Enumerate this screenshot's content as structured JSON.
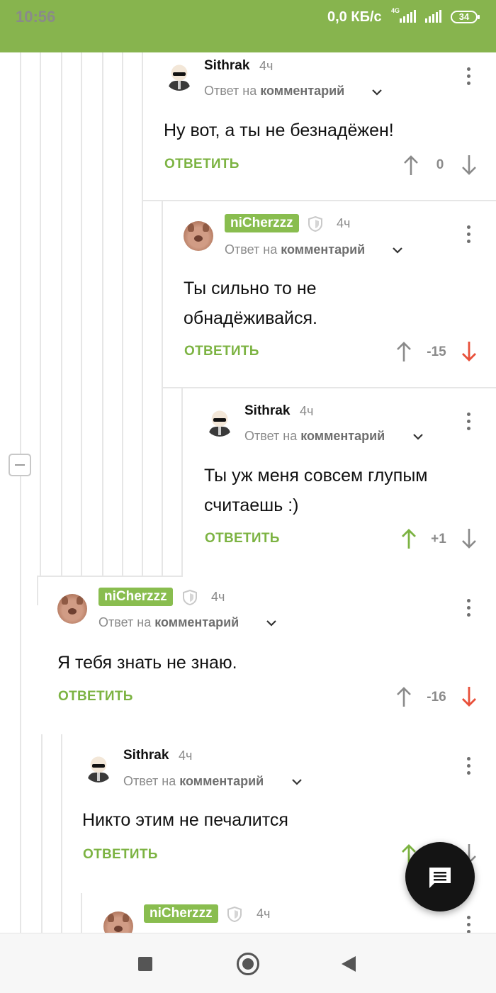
{
  "status_bar": {
    "time": "10:56",
    "net_speed": "0,0 КБ/с",
    "network_type": "4G",
    "battery": "34"
  },
  "icons": {
    "shield": "shield-icon",
    "chevron": "chevron-down-icon",
    "more": "more-vertical-icon",
    "upvote": "arrow-up-icon",
    "downvote": "arrow-down-icon",
    "fab": "comment-icon"
  },
  "colors": {
    "accent": "#87b44e",
    "badge": "#89bd4f",
    "reply_label": "#7cb342",
    "upvoted": "#7cb342",
    "downvoted": "#e8503a",
    "neutral_arrow": "#8a8a8a"
  },
  "comments": [
    {
      "author": "Sithrak",
      "author_badge": false,
      "time": "4ч",
      "reply_prefix": "Ответ на",
      "reply_target": "комментарий",
      "text": "Ну вот, а ты не безнадёжен!",
      "reply_label": "ОТВЕТИТЬ",
      "score": "0",
      "vote": "none"
    },
    {
      "author": "niCherzzz",
      "author_badge": true,
      "time": "4ч",
      "reply_prefix": "Ответ на",
      "reply_target": "комментарий",
      "text": "Ты сильно то не обнадёживайся.",
      "reply_label": "ОТВЕТИТЬ",
      "score": "-15",
      "vote": "down"
    },
    {
      "author": "Sithrak",
      "author_badge": false,
      "time": "4ч",
      "reply_prefix": "Ответ на",
      "reply_target": "комментарий",
      "text": "Ты уж меня совсем глупым считаешь :)",
      "reply_label": "ОТВЕТИТЬ",
      "score": "+1",
      "vote": "up"
    },
    {
      "author": "niCherzzz",
      "author_badge": true,
      "time": "4ч",
      "reply_prefix": "Ответ на",
      "reply_target": "комментарий",
      "text": "Я тебя знать не знаю.",
      "reply_label": "ОТВЕТИТЬ",
      "score": "-16",
      "vote": "down"
    },
    {
      "author": "Sithrak",
      "author_badge": false,
      "time": "4ч",
      "reply_prefix": "Ответ на",
      "reply_target": "комментарий",
      "text": "Никто этим не печалится",
      "reply_label": "ОТВЕТИТЬ",
      "score": "",
      "vote": "up"
    },
    {
      "author": "niCherzzz",
      "author_badge": true,
      "time": "4ч",
      "reply_prefix": "",
      "reply_target": "",
      "text": "",
      "reply_label": "",
      "score": "",
      "vote": "none"
    }
  ]
}
